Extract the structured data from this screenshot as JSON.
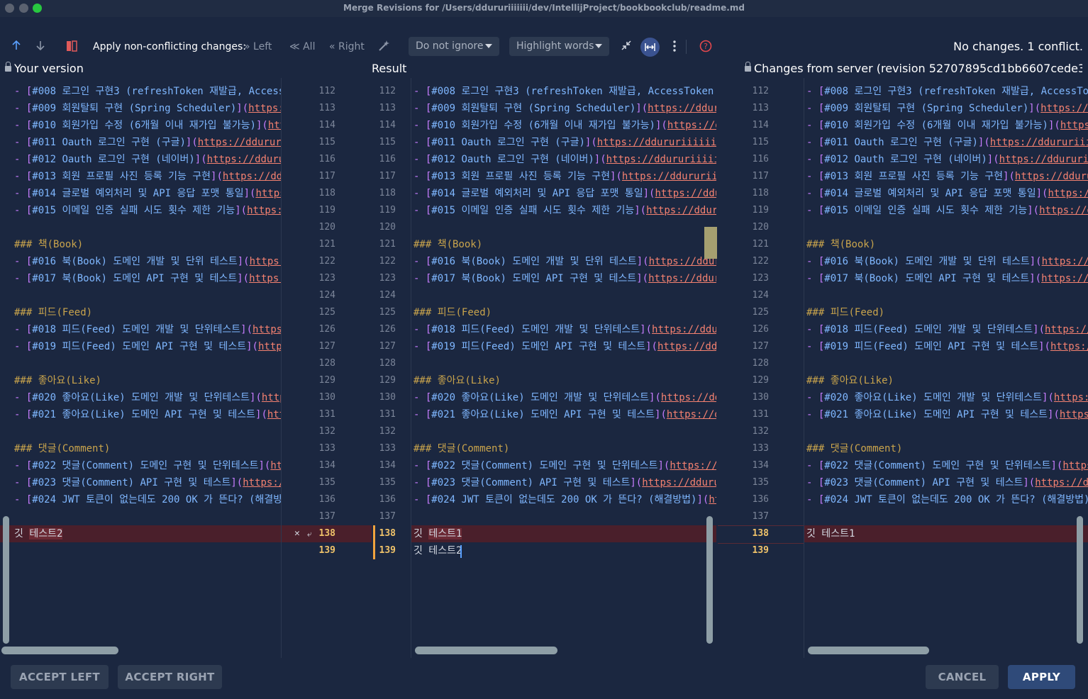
{
  "window": {
    "title": "Merge Revisions for /Users/ddururiiiiiii/dev/IntellijProject/bookbookclub/readme.md"
  },
  "toolbar": {
    "apply_label": "Apply non-conflicting changes:",
    "left_label": "Left",
    "all_label": "All",
    "right_label": "Right",
    "ignore_dropdown": "Do not ignore",
    "highlight_dropdown": "Highlight words",
    "status": "No changes. 1 conflict."
  },
  "panes": {
    "left_title": "Your version",
    "middle_title": "Result",
    "right_title": "Changes from server (revision 52707895cd1bb6607cede3…"
  },
  "left_lines": [
    {
      "text": "- [#008 로그인 구현3 (refreshToken 재발급, Access"
    },
    {
      "text": "- [#009 회원탈퇴 구현 (Spring Scheduler)](https:"
    },
    {
      "text": "- [#010 회원가입 수정 (6개월 이내 재가입 불가능)](http"
    },
    {
      "text": "- [#011 Oauth 로그인 구현 (구글)](https://ddurur"
    },
    {
      "text": "- [#012 Oauth 로그인 구현 (네이버)](https://dduru"
    },
    {
      "text": "- [#013 회원 프로필 사진 등록 기능 구현](https://ddu"
    },
    {
      "text": "- [#014 글로벌 예외처리 및 API 응답 포맷 통일](https"
    },
    {
      "text": "- [#015 이메일 인증 실패 시도 횟수 제한 기능](https:/"
    },
    {
      "text": ""
    },
    {
      "text": "### 책(Book)"
    },
    {
      "text": "- [#016 북(Book) 도메인 개발 및 단위 테스트](https:"
    },
    {
      "text": "- [#017 북(Book) 도메인 API 구현 및 테스트](https:"
    },
    {
      "text": ""
    },
    {
      "text": "### 피드(Feed)"
    },
    {
      "text": "- [#018 피드(Feed) 도메인 개발 및 단위테스트](https:"
    },
    {
      "text": "- [#019 피드(Feed) 도메인 API 구현 및 테스트](https"
    },
    {
      "text": ""
    },
    {
      "text": "### 좋아요(Like)"
    },
    {
      "text": "- [#020 좋아요(Like) 도메인 개발 및 단위테스트](http"
    },
    {
      "text": "- [#021 좋아요(Like) 도메인 API 구현 및 테스트](htt"
    },
    {
      "text": ""
    },
    {
      "text": "### 댓글(Comment)"
    },
    {
      "text": "- [#022 댓글(Comment) 도메인 구현 및 단위테스트](htt"
    },
    {
      "text": "- [#023 댓글(Comment) API 구현 및 테스트](https:/"
    },
    {
      "text": "- [#024 JWT 토큰이 없는데도 200 OK 가 뜬다? (해결방법"
    },
    {
      "text": ""
    },
    {
      "text": "깃 테스트2"
    }
  ],
  "middle_lines": [
    {
      "text": "- [#008 로그인 구현3 (refreshToken 재발급, AccessToken 재"
    },
    {
      "text": "- [#009 회원탈퇴 구현 (Spring Scheduler)](https://dduru"
    },
    {
      "text": "- [#010 회원가입 수정 (6개월 이내 재가입 불가능)](https://dd"
    },
    {
      "text": "- [#011 Oauth 로그인 구현 (구글)](https://ddururiiiiii"
    },
    {
      "text": "- [#012 Oauth 로그인 구현 (네이버)](https://ddururiiiii"
    },
    {
      "text": "- [#013 회원 프로필 사진 등록 기능 구현](https://ddururii"
    },
    {
      "text": "- [#014 글로벌 예외처리 및 API 응답 포맷 통일](https://ddur"
    },
    {
      "text": "- [#015 이메일 인증 실패 시도 횟수 제한 기능](https://dduru"
    },
    {
      "text": ""
    },
    {
      "text": "### 책(Book)"
    },
    {
      "text": "- [#016 북(Book) 도메인 개발 및 단위 테스트](https://ddurc"
    },
    {
      "text": "- [#017 북(Book) 도메인 API 구현 및 테스트](https://ddurc"
    },
    {
      "text": ""
    },
    {
      "text": "### 피드(Feed)"
    },
    {
      "text": "- [#018 피드(Feed) 도메인 개발 및 단위테스트](https://ddur"
    },
    {
      "text": "- [#019 피드(Feed) 도메인 API 구현 및 테스트](https://ddu"
    },
    {
      "text": ""
    },
    {
      "text": "### 좋아요(Like)"
    },
    {
      "text": "- [#020 좋아요(Like) 도메인 개발 및 단위테스트](https://ddu"
    },
    {
      "text": "- [#021 좋아요(Like) 도메인 API 구현 및 테스트](https://dc"
    },
    {
      "text": ""
    },
    {
      "text": "### 댓글(Comment)"
    },
    {
      "text": "- [#022 댓글(Comment) 도메인 구현 및 단위테스트](https://d"
    },
    {
      "text": "- [#023 댓글(Comment) API 구현 및 테스트](https://ddurui"
    },
    {
      "text": "- [#024 JWT 토큰이 없는데도 200 OK 가 뜬다? (해결방법)](htt"
    },
    {
      "text": ""
    },
    {
      "text": "깃 테스트1"
    },
    {
      "text": "깃 테스트2"
    }
  ],
  "right_lines": [
    {
      "text": "- [#008 로그인 구현3 (refreshToken 재발급, AccessTok"
    },
    {
      "text": "- [#009 회원탈퇴 구현 (Spring Scheduler)](https://c"
    },
    {
      "text": "- [#010 회원가입 수정 (6개월 이내 재가입 불가능)](https:"
    },
    {
      "text": "- [#011 Oauth 로그인 구현 (구글)](https://ddururiii"
    },
    {
      "text": "- [#012 Oauth 로그인 구현 (네이버)](https://ddururii"
    },
    {
      "text": "- [#013 회원 프로필 사진 등록 기능 구현](https://dduru"
    },
    {
      "text": "- [#014 글로벌 예외처리 및 API 응답 포맷 통일](https://"
    },
    {
      "text": "- [#015 이메일 인증 실패 시도 횟수 제한 기능](https://dc"
    },
    {
      "text": ""
    },
    {
      "text": "### 책(Book)"
    },
    {
      "text": "- [#016 북(Book) 도메인 개발 및 단위 테스트](https://d"
    },
    {
      "text": "- [#017 북(Book) 도메인 API 구현 및 테스트](https://d"
    },
    {
      "text": ""
    },
    {
      "text": "### 피드(Feed)"
    },
    {
      "text": "- [#018 피드(Feed) 도메인 개발 및 단위테스트](https://c"
    },
    {
      "text": "- [#019 피드(Feed) 도메인 API 구현 및 테스트](https:/"
    },
    {
      "text": ""
    },
    {
      "text": "### 좋아요(Like)"
    },
    {
      "text": "- [#020 좋아요(Like) 도메인 개발 및 단위테스트](https:/"
    },
    {
      "text": "- [#021 좋아요(Like) 도메인 API 구현 및 테스트](https:"
    },
    {
      "text": ""
    },
    {
      "text": "### 댓글(Comment)"
    },
    {
      "text": "- [#022 댓글(Comment) 도메인 구현 및 단위테스트](https:"
    },
    {
      "text": "- [#023 댓글(Comment) API 구현 및 테스트](https://dc"
    },
    {
      "text": "- [#024 JWT 토큰이 없는데도 200 OK 가 뜬다? (해결방법)]"
    },
    {
      "text": ""
    },
    {
      "text": "깃 테스트1"
    },
    {
      "text": ""
    }
  ],
  "line_numbers_left_gutter": [
    "112",
    "113",
    "114",
    "115",
    "116",
    "117",
    "118",
    "119",
    "120",
    "121",
    "122",
    "123",
    "124",
    "125",
    "126",
    "127",
    "128",
    "129",
    "130",
    "131",
    "132",
    "133",
    "134",
    "135",
    "136",
    "137",
    "138",
    "139"
  ],
  "line_numbers_mid_gutter": [
    "112",
    "113",
    "114",
    "115",
    "116",
    "117",
    "118",
    "119",
    "120",
    "121",
    "122",
    "123",
    "124",
    "125",
    "126",
    "127",
    "128",
    "129",
    "130",
    "131",
    "132",
    "133",
    "134",
    "135",
    "136",
    "137",
    "138",
    "139"
  ],
  "line_numbers_right_gutter": [
    "112",
    "113",
    "114",
    "115",
    "116",
    "117",
    "118",
    "119",
    "120",
    "121",
    "122",
    "123",
    "124",
    "125",
    "126",
    "127",
    "128",
    "129",
    "130",
    "131",
    "132",
    "133",
    "134",
    "135",
    "136",
    "137",
    "138",
    "139"
  ],
  "conflict_marks": {
    "reject": "✕",
    "accept": "⤶"
  },
  "buttons": {
    "accept_left": "ACCEPT LEFT",
    "accept_right": "ACCEPT RIGHT",
    "cancel": "CANCEL",
    "apply": "APPLY"
  },
  "colors": {
    "background": "#1b2740",
    "conflict_bg": "#4a1f2b",
    "accent_primary_button": "#2f4a79",
    "link": "#f48170",
    "keyword": "#c77dff",
    "text_blue": "#7fb7ff",
    "heading": "#c9a44c"
  }
}
